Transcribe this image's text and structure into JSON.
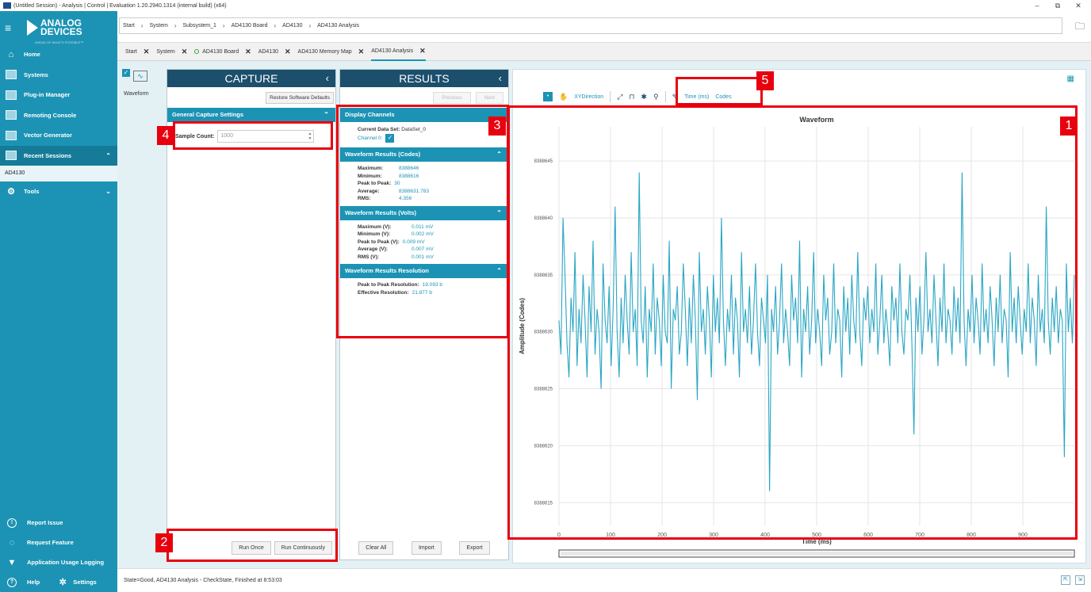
{
  "window": {
    "title": "(Untitled Session) - Analysis | Control | Evaluation 1.20.2940.1314 (internal build) (x64)",
    "minimize": "–",
    "maximize": "⧉",
    "close": "✕"
  },
  "brand": {
    "logo_line1": "ANALOG",
    "logo_line2": "DEVICES",
    "tagline": "AHEAD OF WHAT'S POSSIBLE™"
  },
  "sidebar": {
    "items": [
      {
        "label": "Home",
        "icon": "home-icon"
      },
      {
        "label": "Systems",
        "icon": "systems-icon"
      },
      {
        "label": "Plug-in Manager",
        "icon": "plugin-icon"
      },
      {
        "label": "Remoting Console",
        "icon": "console-icon"
      },
      {
        "label": "Vector Generator",
        "icon": "vector-icon"
      }
    ],
    "recent_sessions": "Recent Sessions",
    "session_item": "AD4130",
    "tools": "Tools",
    "bottom": {
      "report_issue": "Report Issue",
      "request_feature": "Request Feature",
      "usage_logging": "Application Usage Logging",
      "help": "Help",
      "settings": "Settings"
    }
  },
  "breadcrumb": [
    "Start",
    "System",
    "Subsystem_1",
    "AD4130 Board",
    "AD4130",
    "AD4130 Analysis"
  ],
  "tabs": [
    {
      "label": "Start",
      "dot": false
    },
    {
      "label": "System",
      "dot": false
    },
    {
      "label": "AD4130 Board",
      "dot": true
    },
    {
      "label": "AD4130",
      "dot": false
    },
    {
      "label": "AD4130 Memory Map",
      "dot": false
    },
    {
      "label": "AD4130 Analysis",
      "dot": false,
      "active": true
    }
  ],
  "tool": {
    "label": "Waveform"
  },
  "capture": {
    "title": "CAPTURE",
    "restore": "Restore Software Defaults",
    "section": "General Capture Settings",
    "sample_label": "Sample Count:",
    "sample_value": "1000",
    "run_once": "Run Once",
    "run_continuously": "Run Continuously"
  },
  "results": {
    "title": "RESULTS",
    "previous": "Previous",
    "next": "Next",
    "display_channels": "Display Channels",
    "current_dataset": "Current Data Set:",
    "dataset_value": "DataSet_0",
    "channel": "Channel 0:",
    "codes_head": "Waveform Results (Codes)",
    "codes": [
      {
        "k": "Maximum:",
        "v": "8388646"
      },
      {
        "k": "Minimum:",
        "v": "8388616"
      },
      {
        "k": "Peak to Peak:",
        "v": "30"
      },
      {
        "k": "Average:",
        "v": "8388631.783"
      },
      {
        "k": "RMS:",
        "v": "4.356"
      }
    ],
    "volts_head": "Waveform Results (Volts)",
    "volts": [
      {
        "k": "Maximum (V):",
        "v": "0.011 mV"
      },
      {
        "k": "Minimum (V):",
        "v": "0.002 mV"
      },
      {
        "k": "Peak to Peak (V):",
        "v": "0.009 mV"
      },
      {
        "k": "Average (V):",
        "v": "0.007 mV"
      },
      {
        "k": "RMS (V):",
        "v": "0.001 mV"
      }
    ],
    "res_head": "Waveform Results Resolution",
    "resolution": [
      {
        "k": "Peak to Peak Resolution:",
        "v": "19.093 b"
      },
      {
        "k": "Effective Resolution:",
        "v": "21.877 b"
      }
    ],
    "clear_all": "Clear All",
    "import": "Import",
    "export": "Export"
  },
  "plot_toolbar": {
    "xy_direction": "XYDirection",
    "time_ms": "Time (ms)",
    "codes": "Codes"
  },
  "annotations": [
    "1",
    "2",
    "3",
    "4",
    "5"
  ],
  "status": "State=Good, AD4130 Analysis - CheckState, Finished at 8:53:03",
  "chart_data": {
    "type": "line",
    "title": "Waveform",
    "xlabel": "Time (ms)",
    "ylabel": "Amplitude (Codes)",
    "xlim": [
      0,
      1000
    ],
    "ylim": [
      8388613,
      8388648
    ],
    "x_ticks": [
      0,
      100,
      200,
      300,
      400,
      500,
      600,
      700,
      800,
      900
    ],
    "y_ticks": [
      8388615,
      8388620,
      8388625,
      8388630,
      8388635,
      8388640,
      8388645
    ],
    "grid": true,
    "color": "#2aa6c4",
    "series": [
      {
        "values": [
          8388631,
          8388628,
          8388640,
          8388635,
          8388629,
          8388626,
          8388633,
          8388630,
          8388637,
          8388627,
          8388632,
          8388629,
          8388635,
          8388631,
          8388626,
          8388634,
          8388630,
          8388638,
          8388628,
          8388632,
          8388630,
          8388625,
          8388636,
          8388631,
          8388629,
          8388634,
          8388627,
          8388632,
          8388641,
          8388630,
          8388626,
          8388633,
          8388629,
          8388635,
          8388631,
          8388628,
          8388637,
          8388630,
          8388632,
          8388627,
          8388644,
          8388631,
          8388629,
          8388634,
          8388626,
          8388632,
          8388630,
          8388636,
          8388628,
          8388633,
          8388631,
          8388627,
          8388635,
          8388630,
          8388629,
          8388638,
          8388625,
          8388632,
          8388631,
          8388634,
          8388628,
          8388630,
          8388636,
          8388632,
          8388627,
          8388633,
          8388629,
          8388635,
          8388631,
          8388624,
          8388637,
          8388630,
          8388632,
          8388628,
          8388634,
          8388631,
          8388626,
          8388635,
          8388630,
          8388633,
          8388629,
          8388640,
          8388631,
          8388627,
          8388632,
          8388630,
          8388635,
          8388628,
          8388633,
          8388631,
          8388626,
          8388637,
          8388630,
          8388632,
          8388629,
          8388634,
          8388628,
          8388631,
          8388636,
          8388630,
          8388627,
          8388633,
          8388631,
          8388629,
          8388635,
          8388616,
          8388632,
          8388630,
          8388634,
          8388628,
          8388631,
          8388636,
          8388629,
          8388632,
          8388630,
          8388627,
          8388635,
          8388631,
          8388633,
          8388629,
          8388638,
          8388626,
          8388632,
          8388630,
          8388634,
          8388628,
          8388631,
          8388637,
          8388629,
          8388632,
          8388630,
          8388627,
          8388635,
          8388631,
          8388633,
          8388628,
          8388630,
          8388636,
          8388629,
          8388632,
          8388631,
          8388626,
          8388634,
          8388630,
          8388633,
          8388628,
          8388635,
          8388631,
          8388629,
          8388637,
          8388630,
          8388627,
          8388633,
          8388631,
          8388634,
          8388629,
          8388632,
          8388630,
          8388636,
          8388628,
          8388631,
          8388635,
          8388629,
          8388632,
          8388630,
          8388627,
          8388634,
          8388631,
          8388633,
          8388629,
          8388636,
          8388630,
          8388628,
          8388632,
          8388631,
          8388635,
          8388629,
          8388621,
          8388633,
          8388630,
          8388634,
          8388628,
          8388631,
          8388637,
          8388630,
          8388632,
          8388629,
          8388635,
          8388631,
          8388627,
          8388633,
          8388630,
          8388636,
          8388629,
          8388632,
          8388631,
          8388628,
          8388634,
          8388630,
          8388633,
          8388629,
          8388644,
          8388631,
          8388627,
          8388632,
          8388630,
          8388635,
          8388629,
          8388633,
          8388631,
          8388628,
          8388636,
          8388630,
          8388632,
          8388629,
          8388634,
          8388631,
          8388627,
          8388633,
          8388630,
          8388635,
          8388629,
          8388632,
          8388631,
          8388626,
          8388637,
          8388630,
          8388633,
          8388629,
          8388634,
          8388631,
          8388628,
          8388632,
          8388630,
          8388636,
          8388629,
          8388633,
          8388631,
          8388627,
          8388635,
          8388630,
          8388632,
          8388629,
          8388641,
          8388631,
          8388628,
          8388633,
          8388630,
          8388634,
          8388629,
          8388632,
          8388631,
          8388619,
          8388636,
          8388630,
          8388633,
          8388629,
          8388635
        ]
      }
    ]
  }
}
